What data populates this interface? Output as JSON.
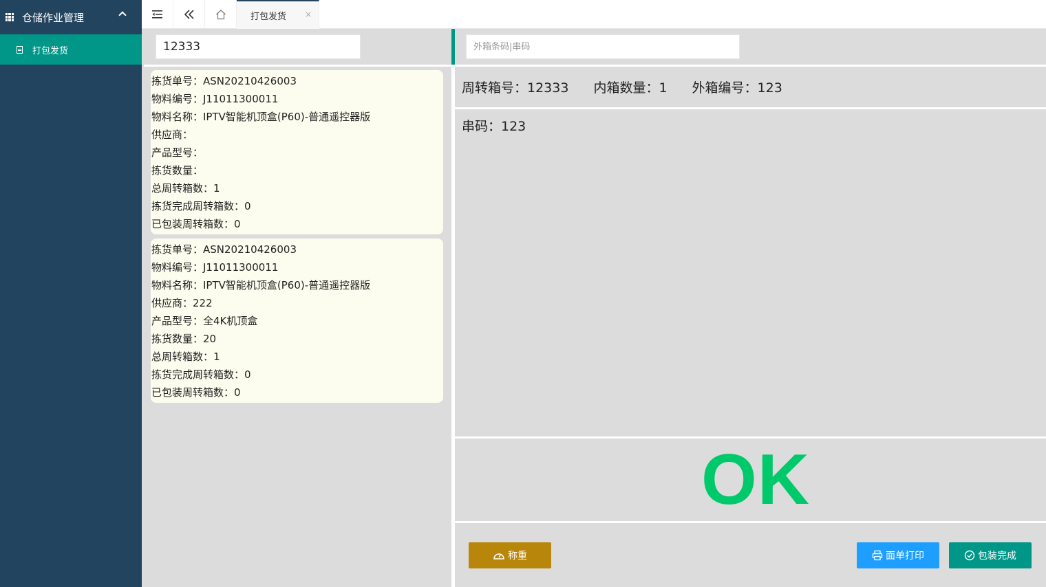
{
  "sidebar": {
    "group_title": "仓储作业管理",
    "items": [
      {
        "label": "打包发货"
      }
    ]
  },
  "topbar": {
    "tabs": [
      {
        "label": "打包发货",
        "close": "×"
      }
    ]
  },
  "left": {
    "scan_value": "12333",
    "cards": [
      {
        "rows": [
          "拣货单号：ASN20210426003",
          "物料编号：J11011300011",
          "物料名称：IPTV智能机顶盒(P60)-普通遥控器版",
          "供应商：",
          "产品型号：",
          "拣货数量：",
          "总周转箱数：1",
          "拣货完成周转箱数：0",
          "已包装周转箱数：0"
        ]
      },
      {
        "rows": [
          "拣货单号：ASN20210426003",
          "物料编号：J11011300011",
          "物料名称：IPTV智能机顶盒(P60)-普通遥控器版",
          "供应商：222",
          "产品型号：全4K机顶盒",
          "拣货数量：20",
          "总周转箱数：1",
          "拣货完成周转箱数：0",
          "已包装周转箱数：0"
        ]
      }
    ]
  },
  "right": {
    "barcode_placeholder": "外箱条码|串码",
    "info": {
      "box_no": "周转箱号：12333",
      "inner_qty": "内箱数量：1",
      "outer_no": "外箱编号：123"
    },
    "serial": "串码：123",
    "status": "OK",
    "status_color": "#00c96b"
  },
  "actions": {
    "weigh": "称重",
    "print": "面单打印",
    "done": "包装完成"
  },
  "colors": {
    "sidebar_bg": "#23445e",
    "accent": "#009688",
    "weigh_btn": "#b8860b",
    "print_btn": "#1e9fff"
  }
}
